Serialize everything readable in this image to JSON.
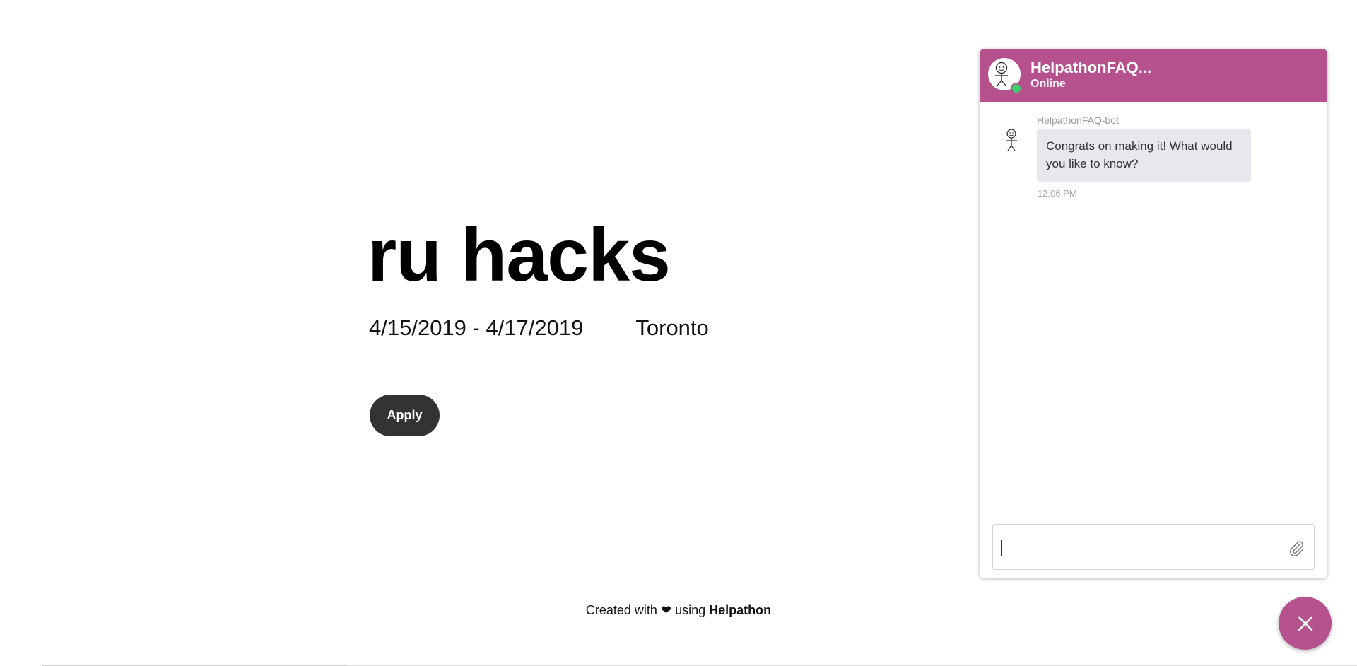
{
  "hero": {
    "title": "ru hacks",
    "dates": "4/15/2019 - 4/17/2019",
    "location": "Toronto",
    "apply_label": "Apply"
  },
  "footer": {
    "prefix": "Created with",
    "heart": "❤",
    "middle": "using",
    "brand": "Helpathon"
  },
  "chat": {
    "header_title": "HelpathonFAQ...",
    "header_status": "Online",
    "messages": [
      {
        "sender": "HelpathonFAQ-bot",
        "text": "Congrats on making it! What would you like to know?",
        "time": "12:06 PM"
      }
    ],
    "input_value": "",
    "attach_icon": "paperclip-icon",
    "close_icon": "close-icon"
  },
  "colors": {
    "accent": "#b5528e",
    "online": "#3ecf6e",
    "apply_button": "#333333",
    "bubble": "#e7e7ee"
  }
}
